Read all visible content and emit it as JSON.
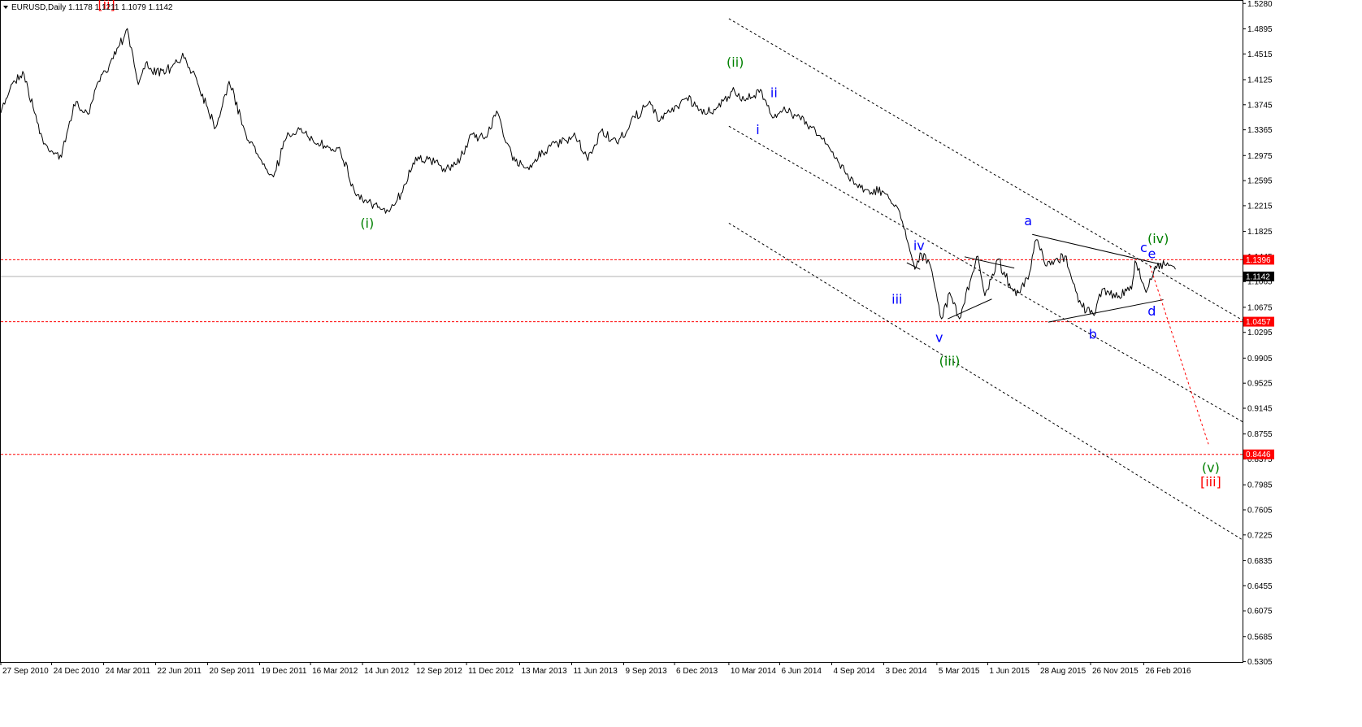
{
  "chart_data": {
    "type": "line",
    "header": {
      "symbol": "EURUSD,Daily",
      "ohlc": "1.1178 1.1211 1.1079 1.1142"
    },
    "y_range": [
      0.53,
      1.532
    ],
    "y_ticks": [
      "1.5280",
      "1.4895",
      "1.4515",
      "1.4125",
      "1.3745",
      "1.3365",
      "1.2975",
      "1.2595",
      "1.2215",
      "1.1825",
      "1.1445",
      "1.1065",
      "1.0675",
      "1.0295",
      "0.9905",
      "0.9525",
      "0.9145",
      "0.8755",
      "0.8375",
      "0.7985",
      "0.7605",
      "0.7225",
      "0.6835",
      "0.6455",
      "0.6075",
      "0.5685",
      "0.5305"
    ],
    "x_ticks": [
      "27 Sep 2010",
      "24 Dec 2010",
      "24 Mar 2011",
      "22 Jun 2011",
      "20 Sep 2011",
      "19 Dec 2011",
      "16 Mar 2012",
      "14 Jun 2012",
      "12 Sep 2012",
      "11 Dec 2012",
      "13 Mar 2013",
      "11 Jun 2013",
      "9 Sep 2013",
      "6 Dec 2013",
      "10 Mar 2014",
      "6 Jun 2014",
      "4 Sep 2014",
      "3 Dec 2014",
      "5 Mar 2015",
      "1 Jun 2015",
      "28 Aug 2015",
      "26 Nov 2015",
      "26 Feb 2016"
    ],
    "x_range": [
      "2010-09-27",
      "2016-08-15"
    ],
    "price_series": {
      "name": "",
      "x": [
        "2010-09-27",
        "2010-10-15",
        "2010-11-04",
        "2010-11-22",
        "2010-12-10",
        "2011-01-10",
        "2011-01-31",
        "2011-02-25",
        "2011-03-15",
        "2011-04-05",
        "2011-05-04",
        "2011-05-23",
        "2011-06-07",
        "2011-06-22",
        "2011-07-18",
        "2011-08-10",
        "2011-08-29",
        "2011-09-20",
        "2011-10-04",
        "2011-10-27",
        "2011-11-25",
        "2011-12-15",
        "2012-01-12",
        "2012-02-01",
        "2012-02-24",
        "2012-03-15",
        "2012-04-16",
        "2012-05-05",
        "2012-06-01",
        "2012-06-18",
        "2012-07-24",
        "2012-08-20",
        "2012-09-14",
        "2012-10-10",
        "2012-11-13",
        "2012-12-05",
        "2012-12-19",
        "2013-01-15",
        "2013-02-01",
        "2013-03-01",
        "2013-03-27",
        "2013-05-01",
        "2013-06-18",
        "2013-07-09",
        "2013-08-01",
        "2013-08-30",
        "2013-09-20",
        "2013-10-24",
        "2013-11-07",
        "2013-12-27",
        "2014-01-30",
        "2014-02-28",
        "2014-03-20",
        "2014-04-01",
        "2014-05-06",
        "2014-05-27",
        "2014-06-16",
        "2014-07-08",
        "2014-07-31",
        "2014-08-26",
        "2014-09-17",
        "2014-10-15",
        "2014-11-07",
        "2014-12-05",
        "2014-12-26",
        "2015-01-09",
        "2015-01-26",
        "2015-02-04",
        "2015-02-20",
        "2015-03-13",
        "2015-03-27",
        "2015-04-13",
        "2015-05-15",
        "2015-05-27",
        "2015-06-18",
        "2015-07-20",
        "2015-08-10",
        "2015-08-24",
        "2015-09-11",
        "2015-10-15",
        "2015-11-05",
        "2015-12-02",
        "2015-12-16",
        "2016-01-14",
        "2016-02-05",
        "2016-02-11",
        "2016-03-01",
        "2016-03-17",
        "2016-04-07",
        "2016-04-21"
      ],
      "y": [
        1.362,
        1.405,
        1.425,
        1.37,
        1.315,
        1.295,
        1.375,
        1.36,
        1.41,
        1.44,
        1.49,
        1.405,
        1.44,
        1.42,
        1.43,
        1.445,
        1.42,
        1.37,
        1.34,
        1.41,
        1.33,
        1.3,
        1.265,
        1.32,
        1.34,
        1.32,
        1.31,
        1.31,
        1.24,
        1.23,
        1.21,
        1.24,
        1.295,
        1.29,
        1.275,
        1.3,
        1.33,
        1.325,
        1.365,
        1.29,
        1.28,
        1.31,
        1.325,
        1.29,
        1.335,
        1.315,
        1.345,
        1.38,
        1.35,
        1.385,
        1.36,
        1.38,
        1.395,
        1.38,
        1.395,
        1.355,
        1.365,
        1.36,
        1.34,
        1.315,
        1.285,
        1.255,
        1.245,
        1.24,
        1.22,
        1.185,
        1.125,
        1.15,
        1.135,
        1.05,
        1.09,
        1.05,
        1.145,
        1.085,
        1.14,
        1.085,
        1.11,
        1.17,
        1.13,
        1.145,
        1.075,
        1.055,
        1.095,
        1.085,
        1.095,
        1.138,
        1.09,
        1.13,
        1.135,
        1.125
      ]
    },
    "levels": [
      {
        "value": 1.1396,
        "label": "1.1396",
        "color": "#ff0000",
        "style": "dashed"
      },
      {
        "value": 1.0457,
        "label": "1.0457",
        "color": "#ff0000",
        "style": "dashed"
      },
      {
        "value": 0.8446,
        "label": "0.8446",
        "color": "#ff0000",
        "style": "dashed"
      },
      {
        "value": 1.1142,
        "label": "1.1142",
        "color": "#000000",
        "style": "solid"
      }
    ],
    "trend_lines": [
      {
        "style": "dotted",
        "color": "#000000",
        "x1": "2014-03-10",
        "y1": 1.505,
        "x2": "2016-08-15",
        "y2": 1.048
      },
      {
        "style": "dotted",
        "color": "#000000",
        "x1": "2014-03-10",
        "y1": 1.342,
        "x2": "2016-08-15",
        "y2": 0.894
      },
      {
        "style": "dotted",
        "color": "#000000",
        "x1": "2014-03-10",
        "y1": 1.195,
        "x2": "2016-08-15",
        "y2": 0.715
      },
      {
        "style": "solid",
        "color": "#000000",
        "x1": "2015-01-12",
        "y1": 1.135,
        "x2": "2015-02-04",
        "y2": 1.125
      },
      {
        "style": "solid",
        "color": "#000000",
        "x1": "2015-03-24",
        "y1": 1.05,
        "x2": "2015-06-08",
        "y2": 1.08
      },
      {
        "style": "solid",
        "color": "#000000",
        "x1": "2015-04-22",
        "y1": 1.144,
        "x2": "2015-07-17",
        "y2": 1.127
      },
      {
        "style": "solid",
        "color": "#000000",
        "x1": "2015-08-17",
        "y1": 1.178,
        "x2": "2016-03-25",
        "y2": 1.133
      },
      {
        "style": "solid",
        "color": "#000000",
        "x1": "2015-09-14",
        "y1": 1.045,
        "x2": "2016-03-31",
        "y2": 1.079
      },
      {
        "style": "dotted",
        "color": "#ff0000",
        "x1": "2016-03-08",
        "y1": 1.13,
        "x2": "2016-06-17",
        "y2": 0.86
      }
    ],
    "wave_labels": [
      {
        "text": "[ii]",
        "x": "2011-03-29",
        "y": 1.52,
        "color": "#ff0000"
      },
      {
        "text": "(ii)",
        "x": "2014-03-21",
        "y": 1.432,
        "color": "#008000"
      },
      {
        "text": "ii",
        "x": "2014-05-27",
        "y": 1.386,
        "color": "#0000ff"
      },
      {
        "text": "i",
        "x": "2014-04-29",
        "y": 1.33,
        "color": "#0000ff"
      },
      {
        "text": "(i)",
        "x": "2012-06-22",
        "y": 1.188,
        "color": "#008000"
      },
      {
        "text": "iv",
        "x": "2015-02-02",
        "y": 1.154,
        "color": "#0000ff"
      },
      {
        "text": "iii",
        "x": "2014-12-26",
        "y": 1.073,
        "color": "#0000ff"
      },
      {
        "text": "v",
        "x": "2015-03-09",
        "y": 1.015,
        "color": "#0000ff"
      },
      {
        "text": "(iii)",
        "x": "2015-03-27",
        "y": 0.979,
        "color": "#008000"
      },
      {
        "text": "a",
        "x": "2015-08-10",
        "y": 1.192,
        "color": "#0000ff"
      },
      {
        "text": "b",
        "x": "2015-11-30",
        "y": 1.02,
        "color": "#0000ff"
      },
      {
        "text": "c",
        "x": "2016-02-26",
        "y": 1.151,
        "color": "#0000ff"
      },
      {
        "text": "(iv)",
        "x": "2016-03-22",
        "y": 1.165,
        "color": "#008000"
      },
      {
        "text": "e",
        "x": "2016-03-11",
        "y": 1.142,
        "color": "#0000ff"
      },
      {
        "text": "d",
        "x": "2016-03-11",
        "y": 1.055,
        "color": "#0000ff"
      },
      {
        "text": "(v)",
        "x": "2016-06-21",
        "y": 0.818,
        "color": "#008000"
      },
      {
        "text": "[iii]",
        "x": "2016-06-21",
        "y": 0.796,
        "color": "#ff0000"
      }
    ]
  }
}
